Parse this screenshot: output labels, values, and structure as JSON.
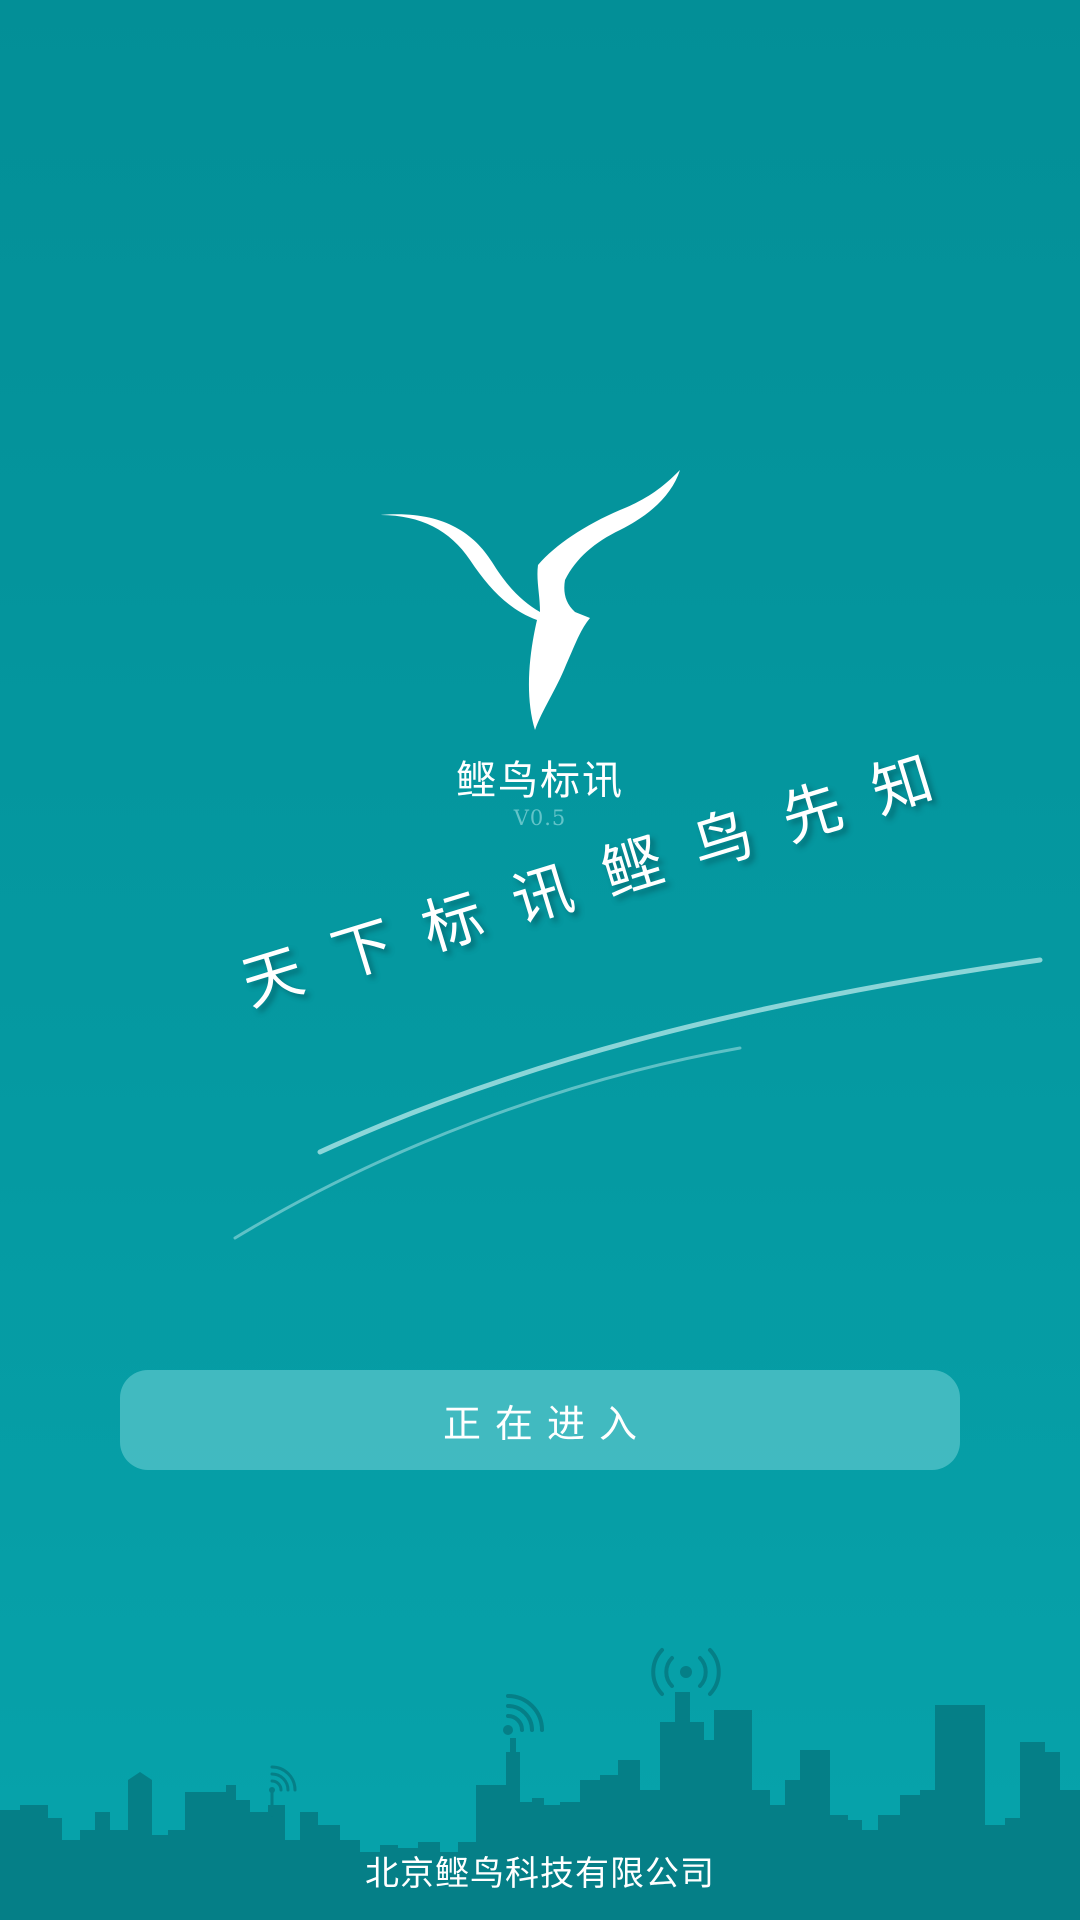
{
  "app": {
    "name": "鲣鸟标讯",
    "version": "V0.5"
  },
  "slogan": "天下标讯鲣鸟先知",
  "enter_button": {
    "label": "正在进入"
  },
  "footer": {
    "company": "北京鲣鸟科技有限公司"
  },
  "icons": {
    "logo": "bird-logo-icon",
    "antennas": "wifi-signal-icon"
  },
  "colors": {
    "background": "#0599a1",
    "button": "#4fbfc5",
    "skyline": "#057f87",
    "text": "#ffffff"
  }
}
